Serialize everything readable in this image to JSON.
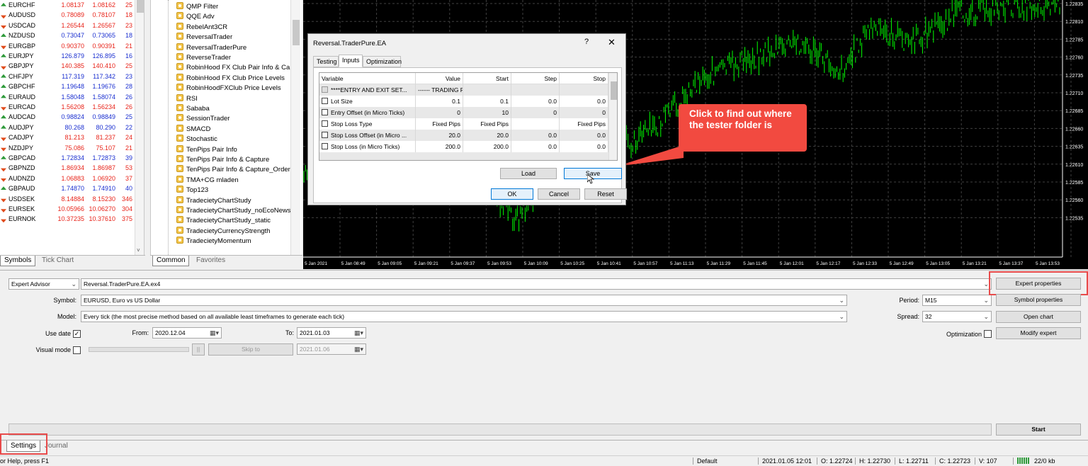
{
  "market_watch": {
    "rows": [
      {
        "symbol": "EURCHF",
        "bid": "1.08137",
        "ask": "1.08162",
        "spread": "25",
        "dir": "up",
        "color": "red"
      },
      {
        "symbol": "AUDUSD",
        "bid": "0.78089",
        "ask": "0.78107",
        "spread": "18",
        "dir": "dn",
        "color": "red"
      },
      {
        "symbol": "USDCAD",
        "bid": "1.26544",
        "ask": "1.26567",
        "spread": "23",
        "dir": "dn",
        "color": "red"
      },
      {
        "symbol": "NZDUSD",
        "bid": "0.73047",
        "ask": "0.73065",
        "spread": "18",
        "dir": "up",
        "color": "blue"
      },
      {
        "symbol": "EURGBP",
        "bid": "0.90370",
        "ask": "0.90391",
        "spread": "21",
        "dir": "dn",
        "color": "red"
      },
      {
        "symbol": "EURJPY",
        "bid": "126.879",
        "ask": "126.895",
        "spread": "16",
        "dir": "up",
        "color": "blue"
      },
      {
        "symbol": "GBPJPY",
        "bid": "140.385",
        "ask": "140.410",
        "spread": "25",
        "dir": "dn",
        "color": "red"
      },
      {
        "symbol": "CHFJPY",
        "bid": "117.319",
        "ask": "117.342",
        "spread": "23",
        "dir": "up",
        "color": "blue"
      },
      {
        "symbol": "GBPCHF",
        "bid": "1.19648",
        "ask": "1.19676",
        "spread": "28",
        "dir": "up",
        "color": "blue"
      },
      {
        "symbol": "EURAUD",
        "bid": "1.58048",
        "ask": "1.58074",
        "spread": "26",
        "dir": "up",
        "color": "blue"
      },
      {
        "symbol": "EURCAD",
        "bid": "1.56208",
        "ask": "1.56234",
        "spread": "26",
        "dir": "dn",
        "color": "red"
      },
      {
        "symbol": "AUDCAD",
        "bid": "0.98824",
        "ask": "0.98849",
        "spread": "25",
        "dir": "up",
        "color": "blue"
      },
      {
        "symbol": "AUDJPY",
        "bid": "80.268",
        "ask": "80.290",
        "spread": "22",
        "dir": "up",
        "color": "blue"
      },
      {
        "symbol": "CADJPY",
        "bid": "81.213",
        "ask": "81.237",
        "spread": "24",
        "dir": "dn",
        "color": "red"
      },
      {
        "symbol": "NZDJPY",
        "bid": "75.086",
        "ask": "75.107",
        "spread": "21",
        "dir": "dn",
        "color": "red"
      },
      {
        "symbol": "GBPCAD",
        "bid": "1.72834",
        "ask": "1.72873",
        "spread": "39",
        "dir": "up",
        "color": "blue"
      },
      {
        "symbol": "GBPNZD",
        "bid": "1.86934",
        "ask": "1.86987",
        "spread": "53",
        "dir": "dn",
        "color": "red"
      },
      {
        "symbol": "AUDNZD",
        "bid": "1.06883",
        "ask": "1.06920",
        "spread": "37",
        "dir": "dn",
        "color": "red"
      },
      {
        "symbol": "GBPAUD",
        "bid": "1.74870",
        "ask": "1.74910",
        "spread": "40",
        "dir": "up",
        "color": "blue"
      },
      {
        "symbol": "USDSEK",
        "bid": "8.14884",
        "ask": "8.15230",
        "spread": "346",
        "dir": "dn",
        "color": "red"
      },
      {
        "symbol": "EURSEK",
        "bid": "10.05966",
        "ask": "10.06270",
        "spread": "304",
        "dir": "dn",
        "color": "red"
      },
      {
        "symbol": "EURNOK",
        "bid": "10.37235",
        "ask": "10.37610",
        "spread": "375",
        "dir": "dn",
        "color": "red"
      }
    ],
    "tabs": [
      "Symbols",
      "Tick Chart"
    ]
  },
  "navigator": {
    "items": [
      "QMP Filter",
      "QQE Adv",
      "RebelAnt3CR",
      "ReversalTrader",
      "ReversalTraderPure",
      "ReverseTrader",
      "RobinHood FX Club Pair Info & Ca",
      "RobinHood FX Club Price Levels",
      "RobinHoodFXClub Price Levels",
      "RSI",
      "Sababa",
      "SessionTrader",
      "SMACD",
      "Stochastic",
      "TenPips Pair Info",
      "TenPips Pair Info & Capture",
      "TenPips Pair Info & Capture_Order",
      "TMA+CG mladen",
      "Top123",
      "TradecietyChartStudy",
      "TradecietyChartStudy_noEcoNews",
      "TradecietyChartStudy_static",
      "TradecietyCurrencyStrength",
      "TradecietyMomentum"
    ],
    "tabs": [
      "Common",
      "Favorites"
    ]
  },
  "chart": {
    "price_labels": [
      "1.22835",
      "1.22810",
      "1.22785",
      "1.22760",
      "1.22735",
      "1.22710",
      "1.22685",
      "1.22660",
      "1.22635",
      "1.22610",
      "1.22585",
      "1.22560",
      "1.22535"
    ],
    "time_labels": [
      "5 Jan 2021",
      "5 Jan 08:49",
      "5 Jan 09:05",
      "5 Jan 09:21",
      "5 Jan 09:37",
      "5 Jan 09:53",
      "5 Jan 10:09",
      "5 Jan 10:25",
      "5 Jan 10:41",
      "5 Jan 10:57",
      "5 Jan 11:13",
      "5 Jan 11:29",
      "5 Jan 11:45",
      "5 Jan 12:01",
      "5 Jan 12:17",
      "5 Jan 12:33",
      "5 Jan 12:49",
      "5 Jan 13:05",
      "5 Jan 13:21",
      "5 Jan 13:37",
      "5 Jan 13:53"
    ],
    "bar_color": "#00ff00",
    "grid_color": "#404040"
  },
  "dialog": {
    "title": "Reversal.TraderPure.EA",
    "help": "?",
    "close": "✕",
    "tabs": [
      "Testing",
      "Inputs",
      "Optimization"
    ],
    "columns": [
      "Variable",
      "Value",
      "Start",
      "Step",
      "Stop"
    ],
    "rows": [
      {
        "variable": "****ENTRY AND EXIT SET...",
        "value": "------ TRADING PARAMETERS",
        "start": "",
        "step": "",
        "stop": "",
        "disabled": true
      },
      {
        "variable": "Lot Size",
        "value": "0.1",
        "start": "0.1",
        "step": "0.0",
        "stop": "0.0"
      },
      {
        "variable": "Entry Offset (in Micro Ticks)",
        "value": "0",
        "start": "10",
        "step": "0",
        "stop": "0"
      },
      {
        "variable": "Stop Loss Type",
        "value": "Fixed Pips",
        "start": "Fixed Pips",
        "step": "",
        "stop": "Fixed Pips"
      },
      {
        "variable": "Stop Loss Offset (in Micro ...",
        "value": "20.0",
        "start": "20.0",
        "step": "0.0",
        "stop": "0.0"
      },
      {
        "variable": "Stop Loss (in Micro Ticks)",
        "value": "200.0",
        "start": "200.0",
        "step": "0.0",
        "stop": "0.0"
      }
    ],
    "load": "Load",
    "save": "Save",
    "ok": "OK",
    "cancel": "Cancel",
    "reset": "Reset"
  },
  "callout": {
    "text": "Click to find out where the tester folder is",
    "color": "#f24a40"
  },
  "tester": {
    "type_value": "Expert Advisor",
    "ea_value": "Reversal.TraderPure.EA.ex4",
    "symbol_label": "Symbol:",
    "symbol_value": "EURUSD, Euro vs US Dollar",
    "model_label": "Model:",
    "model_value": "Every tick (the most precise method based on all available least timeframes to generate each tick)",
    "use_date_label": "Use date",
    "use_date_checked": "✓",
    "from_label": "From:",
    "from_value": "2020.12.04",
    "to_label": "To:",
    "to_value": "2021.01.03",
    "visual_mode_label": "Visual mode",
    "pause": "||",
    "skip_to": "Skip to",
    "skip_date": "2021.01.06",
    "period_label": "Period:",
    "period_value": "M15",
    "spread_label": "Spread:",
    "spread_value": "32",
    "optimization_label": "Optimization",
    "expert_properties": "Expert properties",
    "symbol_properties": "Symbol properties",
    "open_chart": "Open chart",
    "modify_expert": "Modify expert",
    "start": "Start",
    "tabs": [
      "Settings",
      "Journal"
    ],
    "highlight_color": "#e84b4b"
  },
  "statusbar": {
    "help": "or Help, press F1",
    "profile": "Default",
    "datetime": "2021.01.05 12:01",
    "open": "O: 1.22724",
    "high": "H: 1.22730",
    "low": "L: 1.22711",
    "close": "C: 1.22723",
    "volume": "V: 107",
    "traffic": "22/0 kb"
  }
}
